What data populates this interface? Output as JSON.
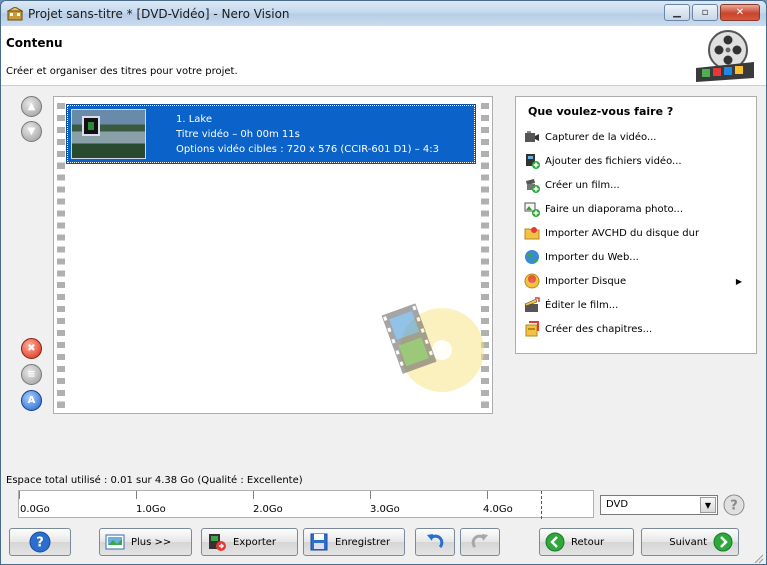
{
  "window": {
    "title": "Projet sans-titre * [DVD-Vidéo] - Nero Vision"
  },
  "header": {
    "title": "Contenu",
    "subtitle": "Créer et organiser des titres pour votre projet."
  },
  "titles": [
    {
      "name": "1. Lake",
      "duration": "Titre vidéo – 0h 00m 11s",
      "options": "Options vidéo cibles : 720 x 576 (CCIR-601 D1) – 4:3"
    }
  ],
  "tasks": {
    "heading": "Que voulez-vous faire ?",
    "items": [
      {
        "label": "Capturer de la vidéo...",
        "icon": "camcorder-icon"
      },
      {
        "label": "Ajouter des fichiers vidéo...",
        "icon": "add-video-icon"
      },
      {
        "label": "Créer un film...",
        "icon": "create-movie-icon"
      },
      {
        "label": "Faire un diaporama photo...",
        "icon": "slideshow-icon"
      },
      {
        "label": "Importer AVCHD du disque dur",
        "icon": "folder-icon"
      },
      {
        "label": "Importer du Web...",
        "icon": "globe-icon"
      },
      {
        "label": "Importer Disque",
        "icon": "disc-icon",
        "submenu": true
      },
      {
        "label": "Éditer le film...",
        "icon": "clapper-icon"
      },
      {
        "label": "Créer des chapitres...",
        "icon": "chapters-icon"
      }
    ]
  },
  "space": {
    "text": "Espace total utilisé : 0.01 sur 4.38 Go (Qualité : Excellente)",
    "used_gb": 0.01,
    "capacity_gb": 4.38,
    "ruler_labels": [
      "0.0Go",
      "1.0Go",
      "2.0Go",
      "3.0Go",
      "4.0Go"
    ]
  },
  "disc_type": {
    "selected": "DVD"
  },
  "bottom": {
    "more_label": "Plus >>",
    "export_label": "Exporter",
    "save_label": "Enregistrer",
    "back_label": "Retour",
    "next_label": "Suivant"
  },
  "colors": {
    "selection": "#0b62c8",
    "accent_green": "#2ea83a",
    "limit_line": "#e02020"
  }
}
